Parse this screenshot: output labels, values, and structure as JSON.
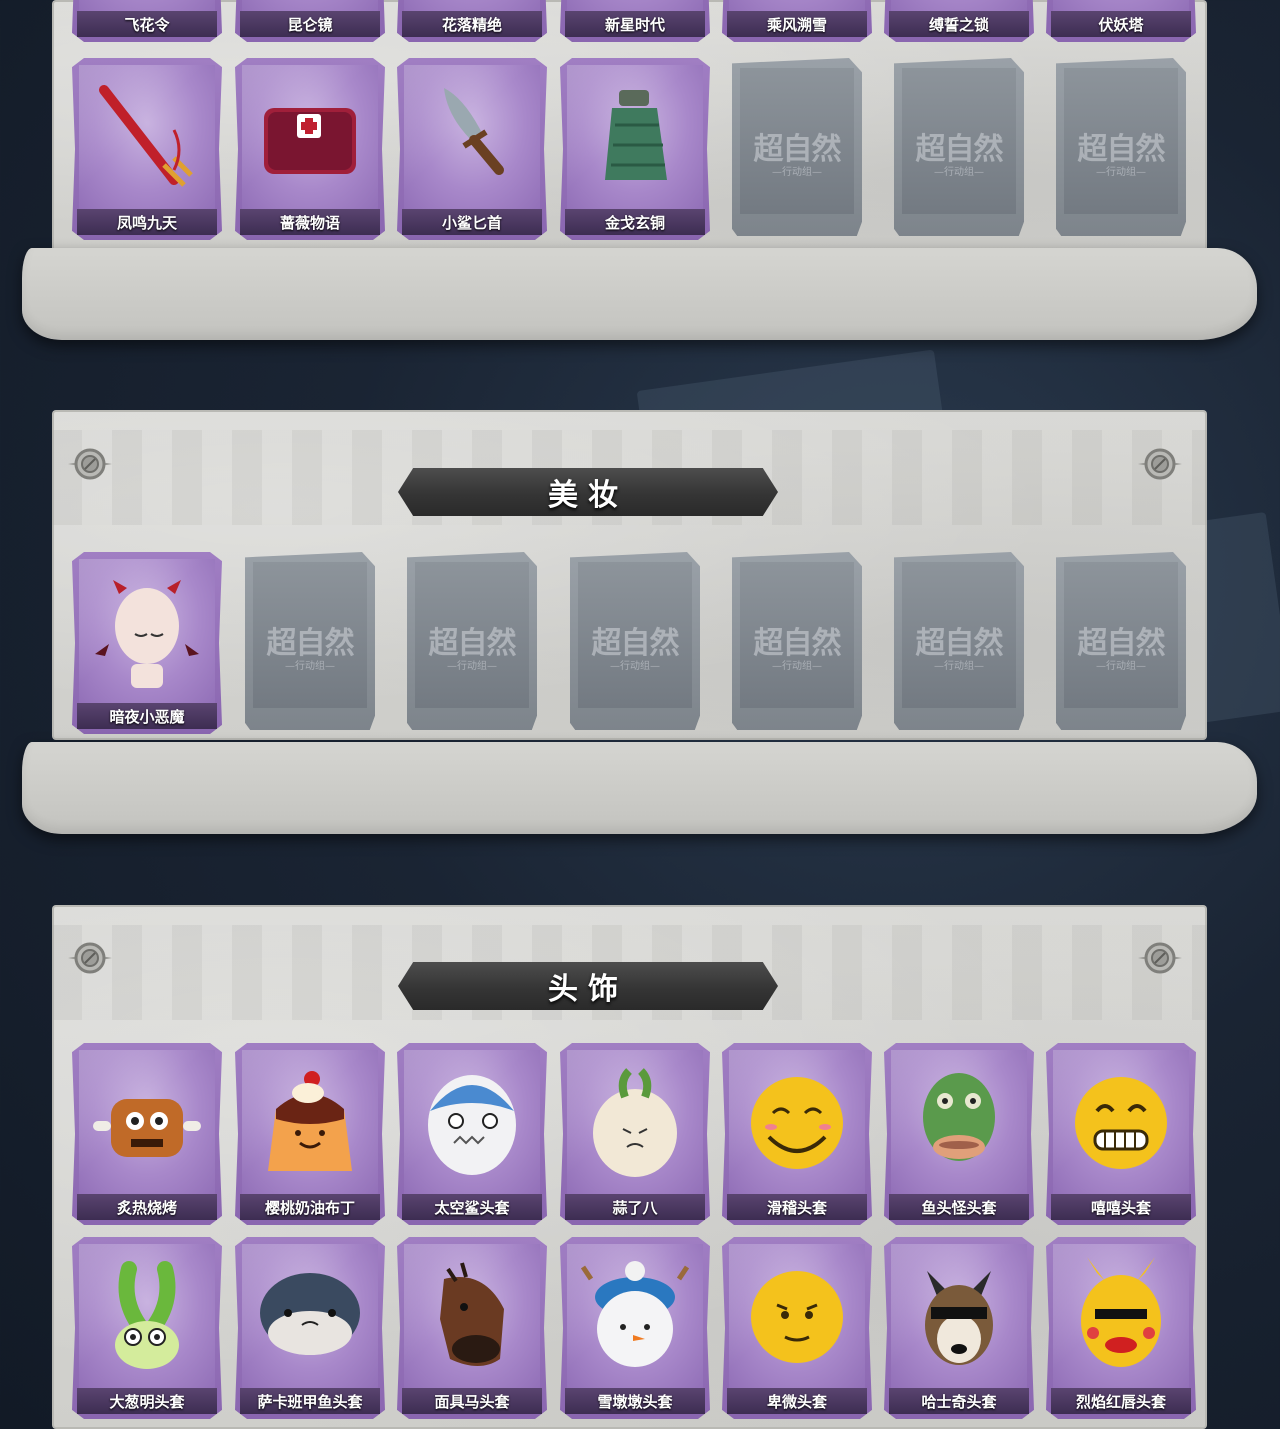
{
  "sections": {
    "weapons": {
      "top_row_labels": [
        "飞花令",
        "昆仑镜",
        "花落精绝",
        "新星时代",
        "乘风溯雪",
        "缚誓之锁",
        "伏妖塔"
      ],
      "bottom_row": [
        {
          "label": "凤鸣九天",
          "icon": "red-sword-icon"
        },
        {
          "label": "蔷薇物语",
          "icon": "medkit-icon"
        },
        {
          "label": "小鲨匕首",
          "icon": "shark-dagger-icon"
        },
        {
          "label": "金戈玄铜",
          "icon": "bronze-grenade-icon"
        }
      ]
    },
    "makeup": {
      "title": "美妆",
      "items": [
        {
          "label": "暗夜小恶魔",
          "icon": "little-devil-face-icon"
        }
      ]
    },
    "headwear": {
      "title": "头饰",
      "row1": [
        {
          "label": "炙热烧烤",
          "icon": "bbq-meat-head-icon"
        },
        {
          "label": "樱桃奶油布丁",
          "icon": "cherry-pudding-head-icon"
        },
        {
          "label": "太空鲨头套",
          "icon": "space-shark-head-icon"
        },
        {
          "label": "蒜了八",
          "icon": "garlic-head-icon"
        },
        {
          "label": "滑稽头套",
          "icon": "funny-smile-head-icon"
        },
        {
          "label": "鱼头怪头套",
          "icon": "fish-monster-head-icon"
        },
        {
          "label": "嘻嘻头套",
          "icon": "grin-emoji-head-icon"
        }
      ],
      "row2": [
        {
          "label": "大葱明头套",
          "icon": "scallion-head-icon"
        },
        {
          "label": "萨卡班甲鱼头套",
          "icon": "sacabambaspis-head-icon"
        },
        {
          "label": "面具马头套",
          "icon": "horse-mask-head-icon"
        },
        {
          "label": "雪墩墩头套",
          "icon": "snowman-head-icon"
        },
        {
          "label": "卑微头套",
          "icon": "humble-emoji-head-icon"
        },
        {
          "label": "哈士奇头套",
          "icon": "husky-sunglasses-head-icon"
        },
        {
          "label": "烈焰红唇头套",
          "icon": "yellow-mouse-head-icon"
        }
      ]
    }
  },
  "empty_slot": {
    "watermark": "超自然",
    "watermark_sub": "—行动组—"
  },
  "colors": {
    "card_purple": "#9a78c0",
    "label_bar": "#4a3860",
    "panel": "#d4d4d0",
    "empty_slot": "#858c93"
  }
}
